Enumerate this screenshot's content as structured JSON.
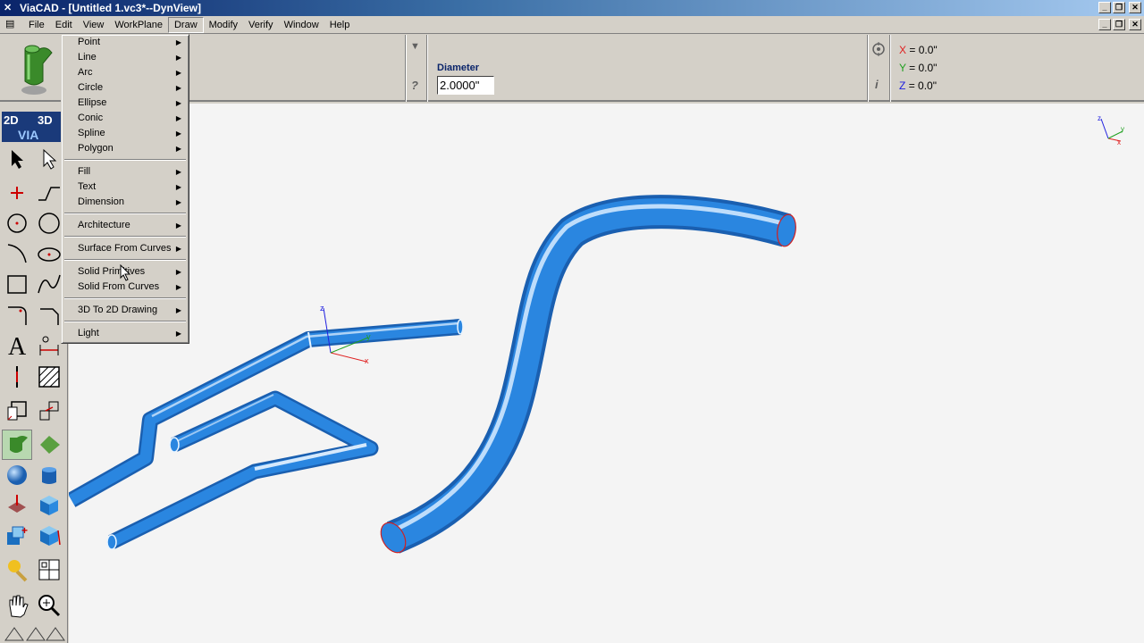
{
  "window": {
    "title": "ViaCAD - [Untitled 1.vc3*--DynView]"
  },
  "menubar": {
    "items": [
      "File",
      "Edit",
      "View",
      "WorkPlane",
      "Draw",
      "Modify",
      "Verify",
      "Window",
      "Help"
    ],
    "active": "Draw"
  },
  "toolbar": {
    "diameter_label": "Diameter",
    "diameter_value": "2.0000\"",
    "coords": {
      "x_label": "X",
      "x_value": "= 0.0\"",
      "y_label": "Y",
      "y_value": "= 0.0\"",
      "z_label": "Z",
      "z_value": "= 0.0\""
    }
  },
  "logo": {
    "text_2d": "2D",
    "text_3d": "3D",
    "text_via": "VIA"
  },
  "draw_menu": {
    "groups": [
      [
        "Point",
        "Line",
        "Arc",
        "Circle",
        "Ellipse",
        "Conic",
        "Spline",
        "Polygon"
      ],
      [
        "Fill",
        "Text",
        "Dimension"
      ],
      [
        "Architecture"
      ],
      [
        "Surface From Curves"
      ],
      [
        "Solid Primitives",
        "Solid From Curves"
      ],
      [
        "3D To 2D Drawing"
      ],
      [
        "Light"
      ]
    ]
  },
  "viewport": {
    "axis_x": "x",
    "axis_y": "y",
    "axis_z": "z"
  },
  "colors": {
    "tube": "#2a86e0",
    "tube_dark": "#1a5fb0",
    "highlight": "#e8f4ff",
    "axis_x": "#e02020",
    "axis_y": "#20a020",
    "axis_z": "#2020e0"
  }
}
